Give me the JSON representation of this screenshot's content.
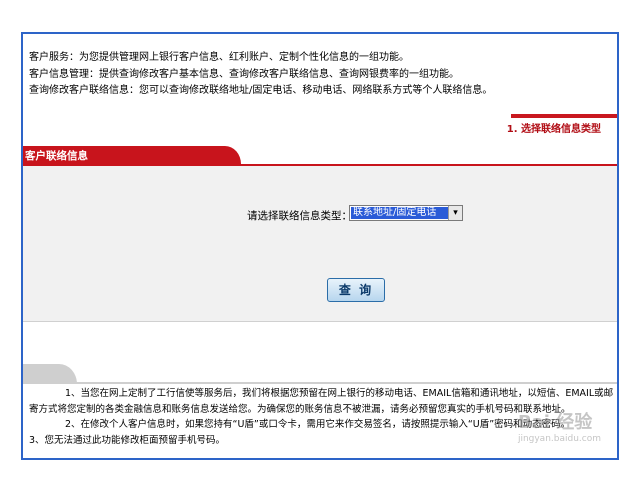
{
  "intro": {
    "line1": "客户服务：为您提供管理网上银行客户信息、红利账户、定制个性化信息的一组功能。",
    "line2": "客户信息管理：提供查询修改客户基本信息、查询修改客户联络信息、查询网银费率的一组功能。",
    "line3": "查询修改客户联络信息：您可以查询修改联络地址/固定电话、移动电话、网络联系方式等个人联络信息。"
  },
  "step_label": "1. 选择联络信息类型",
  "tab": {
    "label": "客户联络信息"
  },
  "form": {
    "select_label": "请选择联络信息类型：",
    "select_value": "联系地址/固定电话",
    "select_arrow": "▾",
    "query_button": "查 询"
  },
  "notes": {
    "note1": "1、当您在网上定制了工行信使等服务后，我们将根据您预留在网上银行的移动电话、EMAIL信箱和通讯地址，以短信、EMAIL或邮寄方式将您定制的各类金融信息和账务信息发送给您。为确保您的账务信息不被泄漏，请务必预留您真实的手机号码和联系地址。",
    "note2": "2、在修改个人客户信息时，如果您持有“U盾”或口令卡，需用它来作交易签名，请按照提示输入“U盾”密码和动态密码。",
    "note3": "3、您无法通过此功能修改柜面预留手机号码。"
  },
  "watermark": {
    "text": "Bai 经验",
    "sub": "jingyan.baidu.com"
  },
  "colors": {
    "accent_red": "#c8141c",
    "frame_blue": "#2d64c8",
    "select_blue": "#2a5bd7"
  }
}
